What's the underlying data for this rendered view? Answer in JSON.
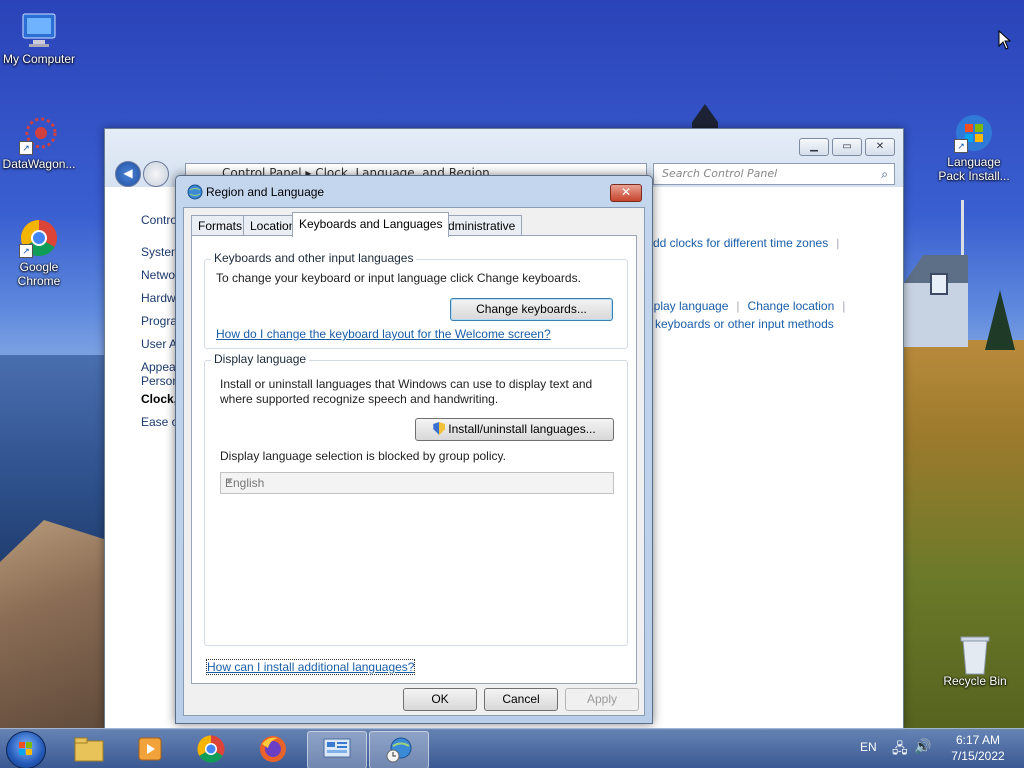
{
  "desktop": {
    "icons": [
      {
        "label": "My Computer"
      },
      {
        "label": "DataWagon..."
      },
      {
        "label": "Google Chrome"
      },
      {
        "label": "Language Pack Install..."
      },
      {
        "label": "Recycle Bin"
      }
    ]
  },
  "control_panel": {
    "address": "Control Panel  ▸  Clock, Language, and Region",
    "search_placeholder": "Search Control Panel",
    "left_items": [
      "Contro",
      "System",
      "Netwo",
      "Hardw",
      "Progra",
      "User A",
      "Appea",
      "Person",
      "Clock,",
      "Ease o"
    ],
    "right_links": {
      "add_clocks": "Add clocks for different time zones",
      "display_language": "isplay language",
      "change_location": "Change location",
      "keyboards": "e keyboards or other input methods"
    }
  },
  "dialog": {
    "title": "Region and Language",
    "tabs": [
      "Formats",
      "Location",
      "Keyboards and Languages",
      "Administrative"
    ],
    "keyboards": {
      "group_title": "Keyboards and other input languages",
      "description": "To change your keyboard or input language click Change keyboards.",
      "change_button": "Change keyboards...",
      "welcome_link": "How do I change the keyboard layout for the Welcome screen?"
    },
    "display_language": {
      "group_title": "Display language",
      "description_line1": "Install or uninstall languages that Windows can use to display text and",
      "description_line2": "where supported recognize speech and handwriting.",
      "install_button": "Install/uninstall languages...",
      "blocked_text": "Display language selection is blocked by group policy.",
      "selected": "English"
    },
    "additional_link": "How can I install additional languages?",
    "ok": "OK",
    "cancel": "Cancel",
    "apply": "Apply"
  },
  "taskbar": {
    "language": "EN",
    "time": "6:17 AM",
    "date": "7/15/2022"
  },
  "colors": {
    "link": "#1a5ea8",
    "dialog_frame": "#b9cee8",
    "close_button": "#c7442b"
  }
}
